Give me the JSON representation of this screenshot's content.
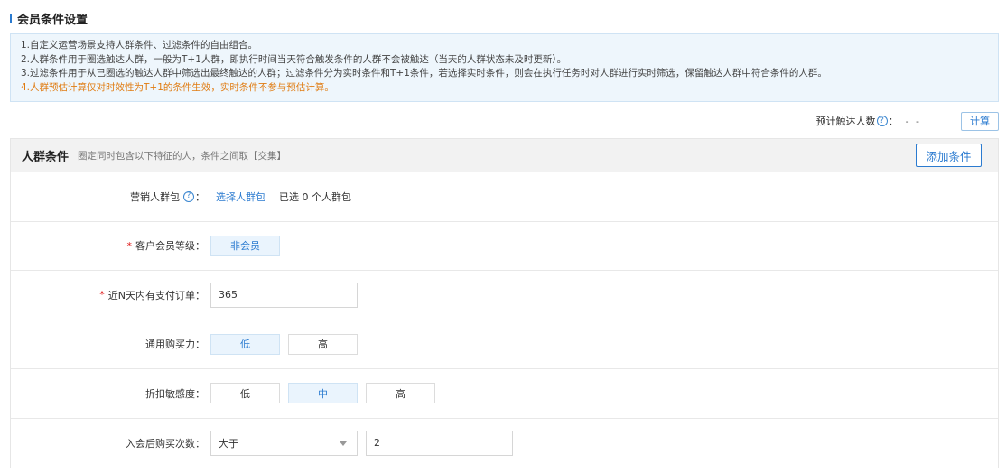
{
  "page": {
    "title": "会员条件设置"
  },
  "notice": {
    "lines": [
      "1.自定义运营场景支持人群条件、过滤条件的自由组合。",
      "2.人群条件用于圈选触达人群，一般为T+1人群，即执行时间当天符合触发条件的人群不会被触达（当天的人群状态未及时更新）。",
      "3.过滤条件用于从已圈选的触达人群中筛选出最终触达的人群；过滤条件分为实时条件和T+1条件，若选择实时条件，则会在执行任务时对人群进行实时筛选，保留触达人群中符合条件的人群。",
      "4.人群预估计算仅对时效性为T+1的条件生效，实时条件不参与预估计算。"
    ]
  },
  "estimate": {
    "label": "预计触达人数",
    "help_icon": "?",
    "colon": "：",
    "value": "- -",
    "calc_label": "计算"
  },
  "panel": {
    "title": "人群条件",
    "desc": "圈定同时包含以下特征的人，条件之间取【交集】",
    "add_label": "添加条件"
  },
  "rows": {
    "package": {
      "label": "营销人群包",
      "help_icon": "?",
      "colon": "：",
      "link": "选择人群包",
      "status": "已选 0 个人群包"
    },
    "level": {
      "label": "客户会员等级：",
      "required": "*",
      "option": "非会员"
    },
    "orders": {
      "label": "近N天内有支付订单：",
      "required": "*",
      "value": "365"
    },
    "power": {
      "label": "通用购买力：",
      "options": [
        "低",
        "高"
      ],
      "selected": "低"
    },
    "discount": {
      "label": "折扣敏感度：",
      "options": [
        "低",
        "中",
        "高"
      ],
      "selected": "中"
    },
    "purchases": {
      "label": "入会后购买次数：",
      "operator": "大于",
      "value": "2"
    }
  }
}
